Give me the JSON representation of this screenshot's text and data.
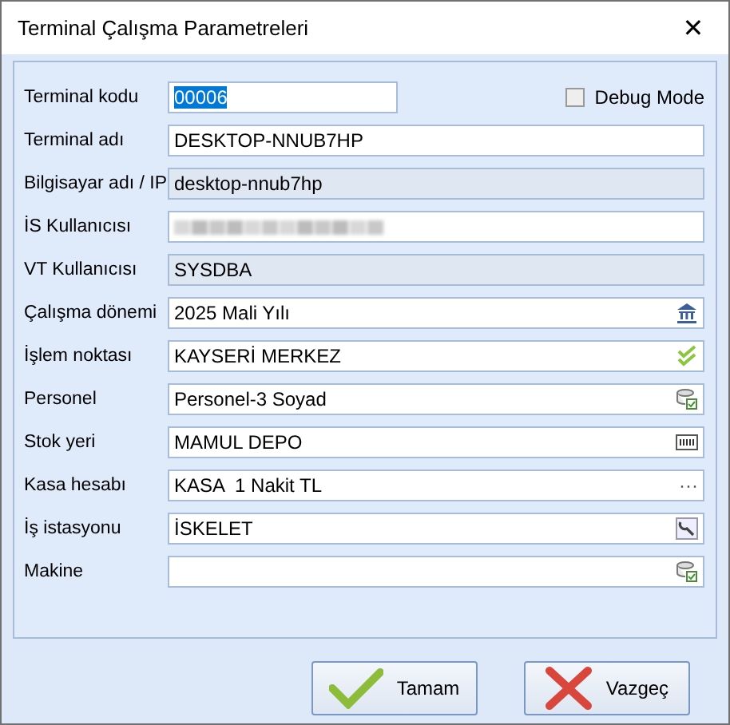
{
  "window": {
    "title": "Terminal Çalışma Parametreleri",
    "close": "✕"
  },
  "debug_mode": {
    "label": "Debug Mode",
    "checked": false
  },
  "fields": [
    {
      "label": "Terminal kodu",
      "value": "00006",
      "kind": "short",
      "value_selected": true
    },
    {
      "label": "Terminal adı",
      "value": "DESKTOP-NNUB7HP",
      "kind": "input"
    },
    {
      "label": "Bilgisayar adı / IP",
      "value": "desktop-nnub7hp",
      "kind": "readonly"
    },
    {
      "label": "İS Kullanıcısı",
      "kind": "redacted"
    },
    {
      "label": "VT Kullanıcısı",
      "value": "SYSDBA",
      "kind": "readonly"
    },
    {
      "label": "Çalışma dönemi",
      "value": "2025 Mali Yılı",
      "kind": "bank"
    },
    {
      "label": "İşlem noktası",
      "value": "KAYSERİ MERKEZ",
      "kind": "check"
    },
    {
      "label": "Personel",
      "value": "Personel-3 Soyad",
      "kind": "db"
    },
    {
      "label": "Stok yeri",
      "value": "MAMUL DEPO",
      "kind": "barcode"
    },
    {
      "label": "Kasa hesabı",
      "value": "KASA  1 Nakit TL",
      "kind": "input",
      "button_text": "···"
    },
    {
      "label": "İş istasyonu",
      "value": "İSKELET",
      "kind": "wrench"
    },
    {
      "label": "Makine",
      "kind": "db"
    }
  ],
  "buttons": [
    {
      "label": "Tamam",
      "kind": "ok"
    },
    {
      "label": "Vazgeç",
      "kind": "cancel"
    }
  ]
}
